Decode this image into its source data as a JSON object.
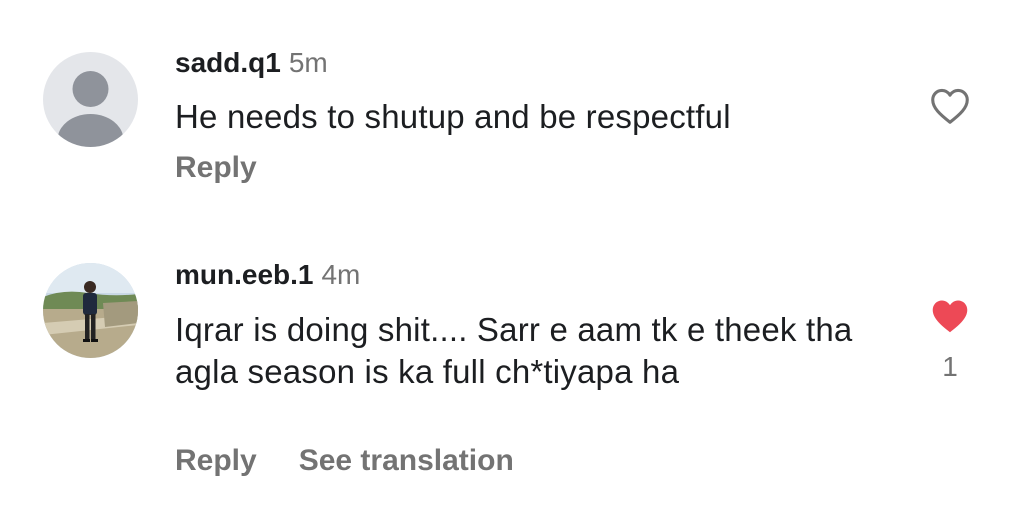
{
  "comments": [
    {
      "username": "sadd.q1",
      "time": "5m",
      "text": "He needs to shutup and be respectful",
      "reply_label": "Reply",
      "liked": false,
      "like_count": ""
    },
    {
      "username": "mun.eeb.1",
      "time": "4m",
      "text": "Iqrar is doing shit.... Sarr e aam tk e theek tha agla season is ka full ch*tiyapa ha",
      "reply_label": "Reply",
      "translate_label": "See translation",
      "liked": true,
      "like_count": "1"
    }
  ],
  "colors": {
    "heart_liked": "#ed4956",
    "meta_gray": "#737373",
    "placeholder_avatar_bg": "#e4e6ea",
    "placeholder_avatar_fg": "#8f939b"
  },
  "icons": {
    "avatar_1": "default-user-avatar",
    "avatar_2": "user-photo-avatar",
    "like_1": "heart-outline-icon",
    "like_2": "heart-filled-icon"
  }
}
